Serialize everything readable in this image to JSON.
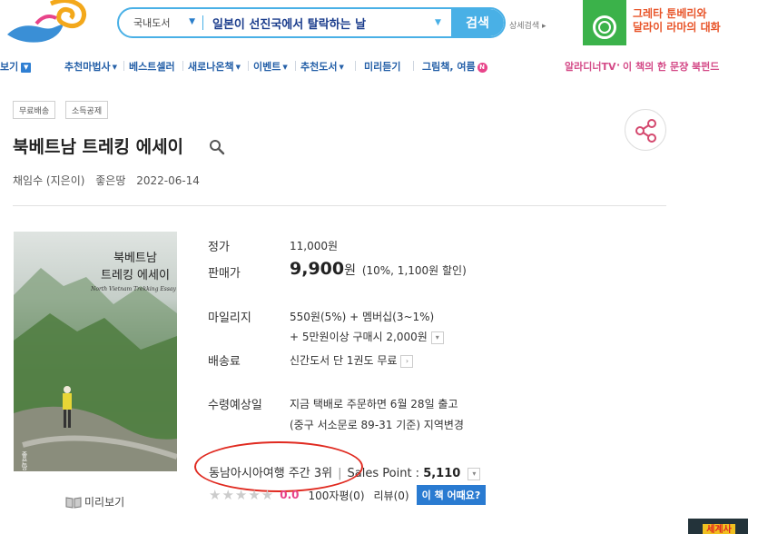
{
  "header": {
    "search_category": "국내도서",
    "search_query": "일본이 선진국에서 탈락하는 날",
    "search_button": "검색",
    "detail_search": "상세검색",
    "promo_line1": "그레타 툰베리와",
    "promo_line2": "달라이 라마의 대화"
  },
  "nav": {
    "items": [
      "보기",
      "추천마법사",
      "베스트셀러",
      "새로나온책",
      "이벤트",
      "추천도서",
      "미리듣기",
      "그림책, 여름"
    ],
    "badge_new": "N",
    "right_links": [
      "알라디너TV",
      "이 책의 한 문장",
      "북펀드"
    ]
  },
  "book": {
    "tags": [
      "무료배송",
      "소득공제"
    ],
    "title": "북베트남 트레킹 에세이",
    "author": "채임수 (지은이)",
    "publisher": "좋은땅",
    "date": "2022-06-14",
    "cover_title_line1": "북베트남",
    "cover_title_line2": "트레킹 에세이",
    "cover_subtitle": "North Vietnam Trekking Essay",
    "cover_publisher": "좋은땅",
    "preview_label": "미리보기"
  },
  "info": {
    "list_price_label": "정가",
    "list_price": "11,000원",
    "sale_price_label": "판매가",
    "sale_price": "9,900",
    "sale_unit": "원",
    "sale_discount": "(10%, 1,100원 할인)",
    "mileage_label": "마일리지",
    "mileage_line1": "550원(5%) + 멤버십(3~1%)",
    "mileage_line2": "+ 5만원이상 구매시 2,000원",
    "shipping_label": "배송료",
    "shipping_value": "신간도서 단 1권도 무료",
    "delivery_label": "수령예상일",
    "delivery_line1": "지금 택배로 주문하면 6월 28일 출고",
    "delivery_line2": "(중구 서소문로 89-31 기준) 지역변경",
    "rank_text": "동남아시아여행 주간 3위",
    "sales_point_label": "Sales Point :",
    "sales_point_value": "5,110",
    "rating_score": "0.0",
    "review_100": "100자평(0)",
    "review": "리뷰(0)",
    "how_button": "이 책 어때요?"
  },
  "ad": {
    "thumb_text": "세계사"
  },
  "colors": {
    "accent": "#49b0e6",
    "nav_blue": "#2560a8",
    "highlight_circle": "#e02a20",
    "pink": "#e8448a"
  }
}
